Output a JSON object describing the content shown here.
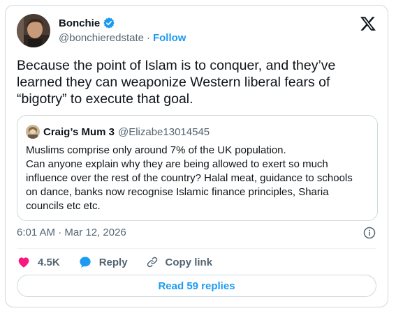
{
  "author": {
    "name": "Bonchie",
    "handle": "@bonchieredstate",
    "separator": "·",
    "follow_label": "Follow"
  },
  "tweet": {
    "lines": [
      "Because the point of Islam is to conquer, and they’ve",
      "learned they can weaponize Western liberal fears of",
      "“bigotry” to execute that goal."
    ]
  },
  "quote": {
    "name": "Craig’s Mum 3",
    "handle": "@Elizabe13014545",
    "lines": [
      "Muslims comprise only around 7% of the UK population.",
      "Can anyone explain why they are being allowed to exert so much",
      "influence over the rest of the country? Halal meat, guidance to schools",
      "on dance, banks now recognise Islamic finance principles, Sharia",
      "councils etc etc."
    ]
  },
  "timestamp": "6:01 AM · Mar 12, 2026",
  "actions": {
    "likes": "4.5K",
    "reply_label": "Reply",
    "copy_label": "Copy link"
  },
  "read_replies_label": "Read 59 replies",
  "colors": {
    "accent": "#1d9bf0",
    "like": "#f91880",
    "muted": "#536471",
    "text": "#0f1419",
    "border": "#cfd9de"
  },
  "icons": [
    "x-logo-icon",
    "verified-badge-icon",
    "info-icon",
    "heart-icon",
    "reply-bubble-icon",
    "link-icon"
  ]
}
